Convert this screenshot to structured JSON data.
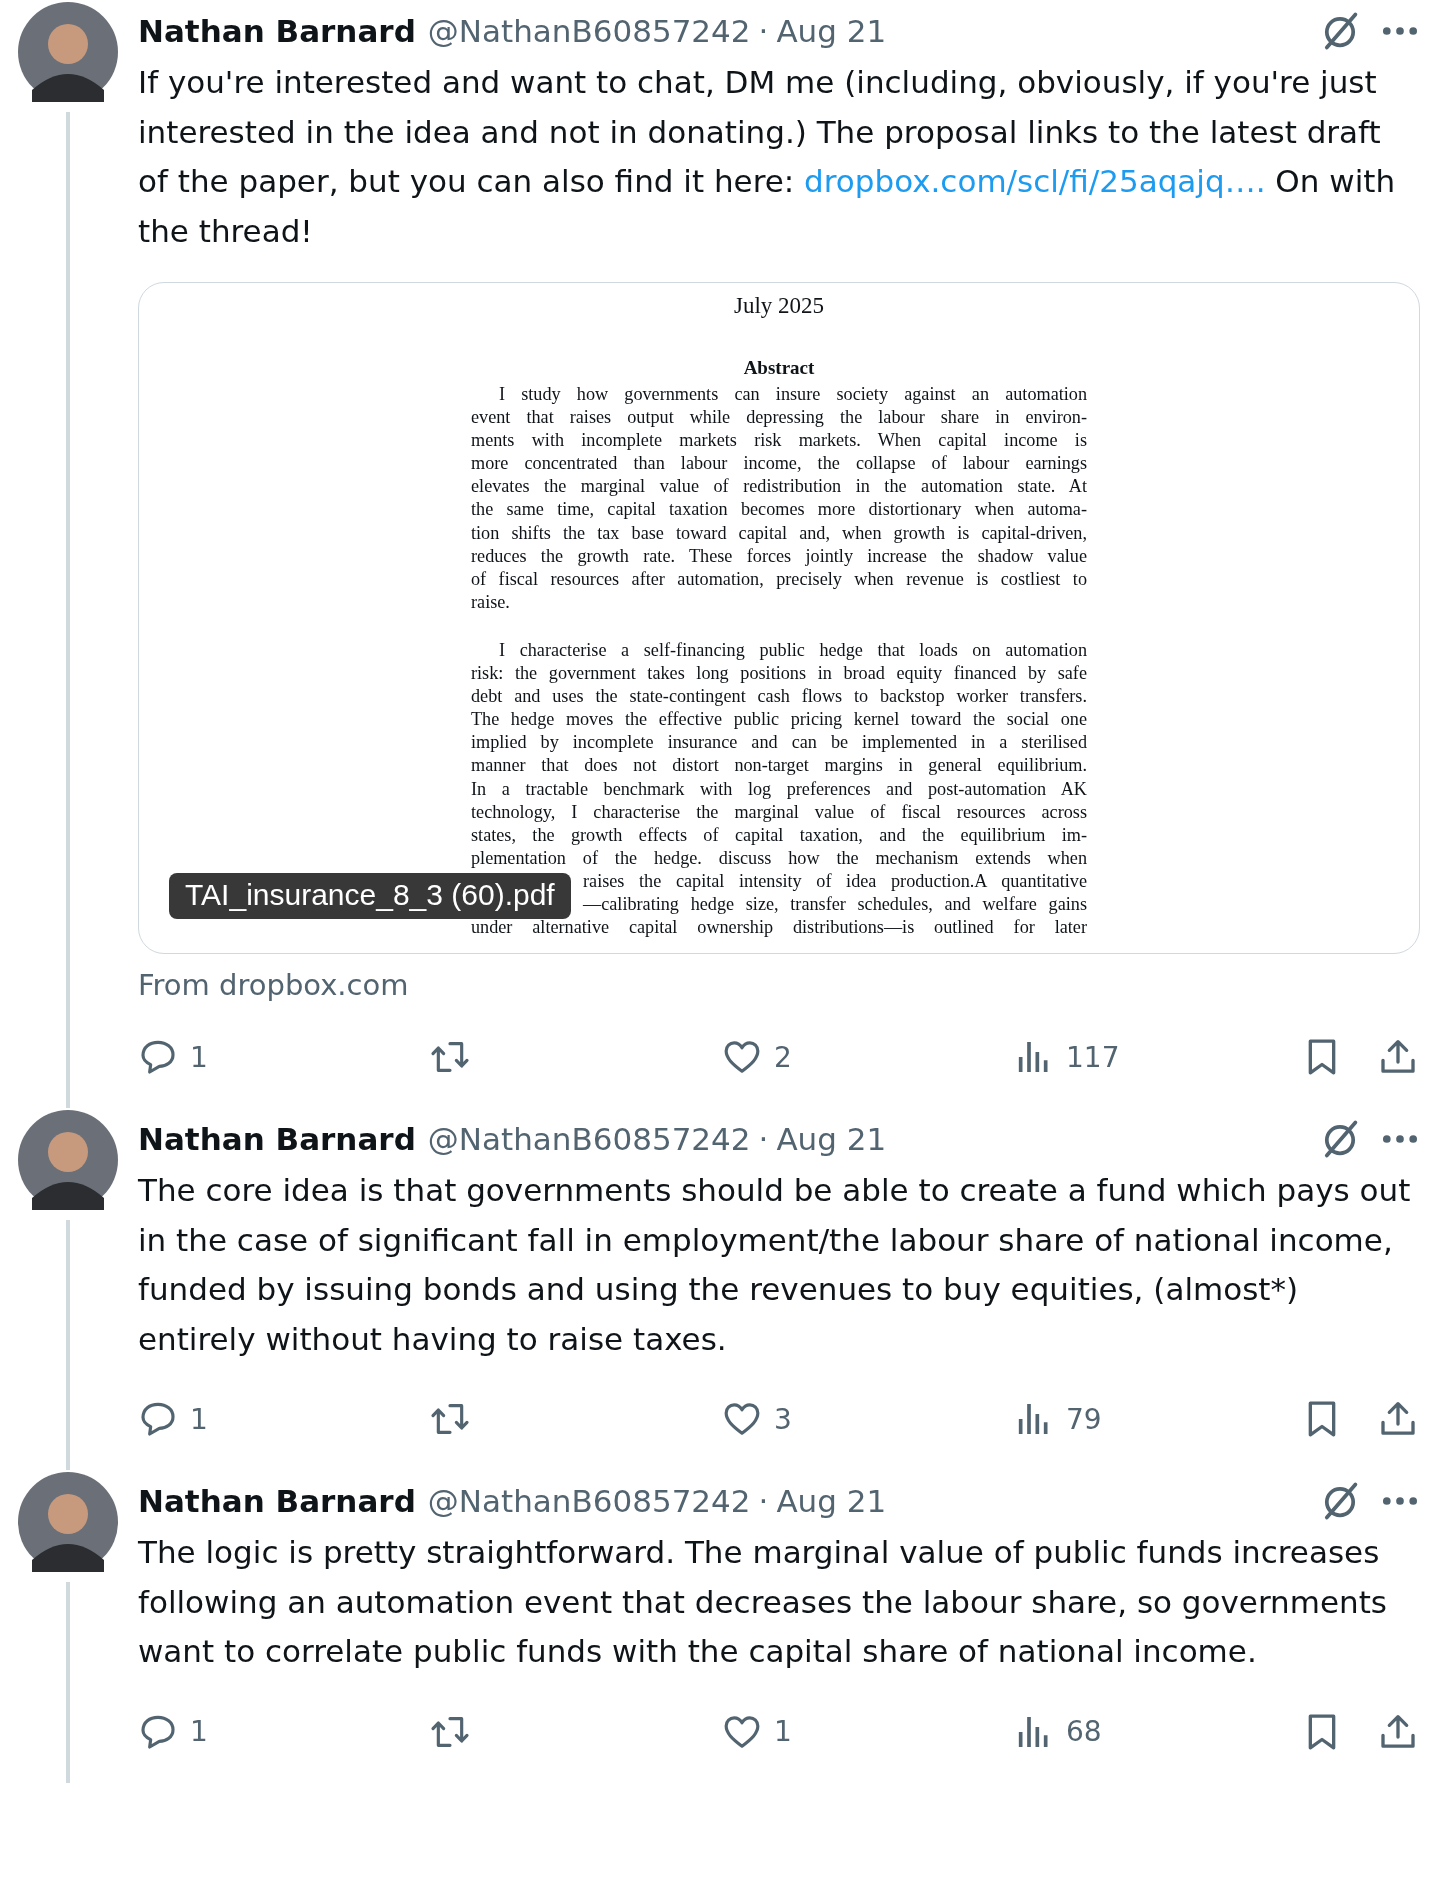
{
  "tweets": [
    {
      "name": "Nathan Barnard",
      "handle": "@NathanB60857242",
      "separator": "·",
      "date": "Aug 21",
      "thread_line": true,
      "body": [
        {
          "kind": "text",
          "text": "If you're interested and want to chat, DM me (including, obviously, if you're just interested in the idea and not in donating.) The proposal links to the latest draft of the paper, but you can also find it here: "
        },
        {
          "kind": "link",
          "text": "dropbox.com/scl/fi/25aqajq…."
        },
        {
          "kind": "text",
          "text": " On with the thread!"
        }
      ],
      "card": {
        "date": "July 2025",
        "heading": "Abstract",
        "paragraphs": [
          {
            "lines": [
              {
                "text": "I study how governments can insure society against an automation",
                "kind": "indent"
              },
              {
                "text": "event that raises output while depressing the labour share in environ-",
                "kind": "full"
              },
              {
                "text": "ments with incomplete markets risk markets.  When capital income is",
                "kind": "full"
              },
              {
                "text": "more concentrated than labour income, the collapse of labour earnings",
                "kind": "full"
              },
              {
                "text": "elevates the marginal value of redistribution in the automation state. At",
                "kind": "full"
              },
              {
                "text": "the same time, capital taxation becomes more distortionary when automa-",
                "kind": "full"
              },
              {
                "text": "tion shifts the tax base toward capital and, when growth is capital-driven,",
                "kind": "full"
              },
              {
                "text": "reduces the growth rate.  These forces jointly increase the shadow value",
                "kind": "full"
              },
              {
                "text": "of fiscal resources after automation, precisely when revenue is costliest to",
                "kind": "full"
              },
              {
                "text": "raise.",
                "kind": "last"
              }
            ]
          },
          {
            "lines": [
              {
                "text": "I characterise a self-financing public hedge that loads on automation",
                "kind": "indent"
              },
              {
                "text": "risk: the government takes long positions in broad equity financed by safe",
                "kind": "full"
              },
              {
                "text": "debt and uses the state-contingent cash flows to backstop worker transfers.",
                "kind": "full"
              },
              {
                "text": "The hedge moves the effective public pricing kernel toward the social one",
                "kind": "full"
              },
              {
                "text": "implied by incomplete insurance and can be implemented in a sterilised",
                "kind": "full"
              },
              {
                "text": "manner that does not distort non-target margins in general equilibrium.",
                "kind": "full"
              },
              {
                "text": "In a tractable benchmark with log preferences and post-automation AK",
                "kind": "full"
              },
              {
                "text": "technology, I characterise the marginal value of fiscal resources across",
                "kind": "full"
              },
              {
                "text": "states, the growth effects of capital taxation, and the equilibrium im-",
                "kind": "full"
              },
              {
                "text": "plementation of the hedge.  discuss how the mechanism extends when",
                "kind": "full"
              },
              {
                "text": "raises the capital intensity of idea production.A quantitative",
                "kind": "covered"
              },
              {
                "text": "—calibrating hedge size, transfer schedules, and welfare gains",
                "kind": "covered"
              },
              {
                "text": "under alternative capital ownership distributions—is outlined for later",
                "kind": "full"
              }
            ]
          }
        ],
        "filename": "TAI_insurance_8_3 (60).pdf",
        "source": "From dropbox.com"
      },
      "replies": "1",
      "likes": "2",
      "views": "117"
    },
    {
      "name": "Nathan Barnard",
      "handle": "@NathanB60857242",
      "separator": "·",
      "date": "Aug 21",
      "thread_line": true,
      "body": [
        {
          "kind": "text",
          "text": "The core idea is that governments should be able to create a fund which pays out in the case of significant fall in employment/the labour share of national income, funded by issuing bonds and using the revenues to buy equities, (almost*) entirely without having to raise taxes."
        }
      ],
      "replies": "1",
      "likes": "3",
      "views": "79"
    },
    {
      "name": "Nathan Barnard",
      "handle": "@NathanB60857242",
      "separator": "·",
      "date": "Aug 21",
      "thread_line": true,
      "body": [
        {
          "kind": "text",
          "text": "The logic is pretty straightforward. The marginal value of public funds increases following an automation event that decreases the labour share, so governments want to correlate public funds with the capital share of national income."
        }
      ],
      "replies": "1",
      "likes": "1",
      "views": "68"
    }
  ]
}
